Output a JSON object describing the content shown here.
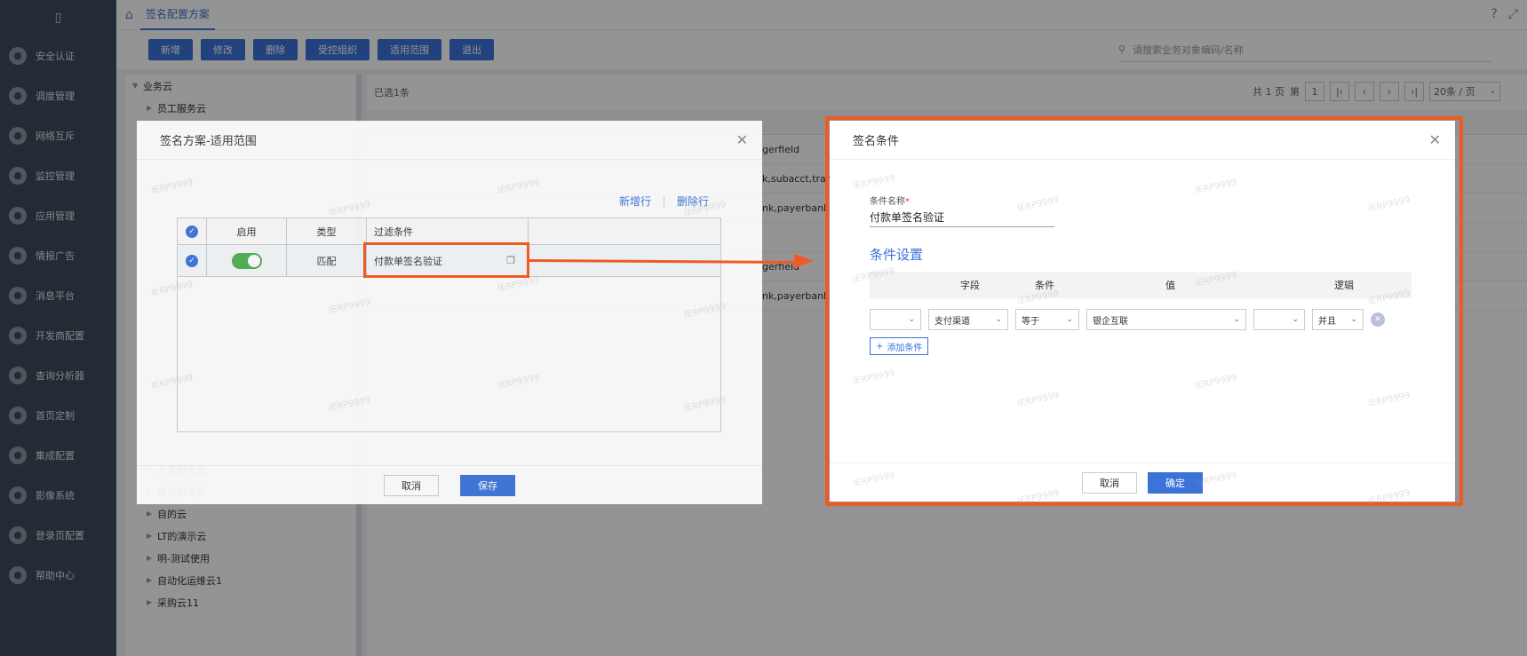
{
  "app": {
    "tab_label": "签名配置方案"
  },
  "sidebar": {
    "items": [
      {
        "label": "安全认证",
        "icon": "shield-icon"
      },
      {
        "label": "调度管理",
        "icon": "schedule-icon"
      },
      {
        "label": "网络互斥",
        "icon": "network-icon"
      },
      {
        "label": "监控管理",
        "icon": "monitor-icon"
      },
      {
        "label": "应用管理",
        "icon": "apps-icon"
      },
      {
        "label": "情报广告",
        "icon": "ad-icon"
      },
      {
        "label": "消息平台",
        "icon": "message-icon"
      },
      {
        "label": "开发商配置",
        "icon": "developer-icon"
      },
      {
        "label": "查询分析器",
        "icon": "search-icon"
      },
      {
        "label": "首页定制",
        "icon": "home-icon"
      },
      {
        "label": "集成配置",
        "icon": "integration-icon"
      },
      {
        "label": "影像系统",
        "icon": "image-icon"
      },
      {
        "label": "登录页配置",
        "icon": "login-icon"
      },
      {
        "label": "帮助中心",
        "icon": "help-icon"
      }
    ]
  },
  "toolbar": {
    "buttons": [
      "新增",
      "修改",
      "删除",
      "受控组织",
      "适用范围",
      "退出"
    ]
  },
  "search": {
    "placeholder": "请搜索业务对象编码/名称"
  },
  "tree": {
    "root": "业务云",
    "items_top": [
      "员工服务云"
    ],
    "items_bottom": [
      "开发服务云",
      "集成服务云",
      "自的云",
      "LT的演示云",
      "明-测试使用",
      "自动化运维云1",
      "采购云11"
    ]
  },
  "grid": {
    "selected_text": "已选1条",
    "pager": {
      "total_pages": "共 1 页",
      "page_label": "第",
      "page": "1",
      "page_size": "20条 / 页"
    },
    "rows": [
      "gerfield",
      "k,subacct,trans",
      "nk,payerbank,",
      "",
      "gerfield",
      "nk,payerbank"
    ]
  },
  "modal_scope": {
    "title": "签名方案-适用范围",
    "add_row": "新增行",
    "delete_row": "删除行",
    "headers": {
      "enable": "启用",
      "type": "类型",
      "filter": "过滤条件"
    },
    "row": {
      "type": "匹配",
      "filter": "付款单签名验证"
    },
    "cancel": "取消",
    "save": "保存"
  },
  "modal_condition": {
    "title": "签名条件",
    "name_label": "条件名称",
    "name_required": "*",
    "name_value": "付款单签名验证",
    "section_title": "条件设置",
    "headers": {
      "field": "字段",
      "condition": "条件",
      "value": "值",
      "logic": "逻辑"
    },
    "row": {
      "paren_open": "",
      "field": "支付渠道",
      "condition": "等于",
      "value": "银企互联",
      "paren_close": "",
      "logic": "并且"
    },
    "add_condition": "添加条件",
    "cancel": "取消",
    "confirm": "确定"
  },
  "watermark_text": "IERP9999",
  "colors": {
    "accent": "#3b73d9",
    "highlight": "#f05a22",
    "sidebar": "#3d4a5c"
  }
}
